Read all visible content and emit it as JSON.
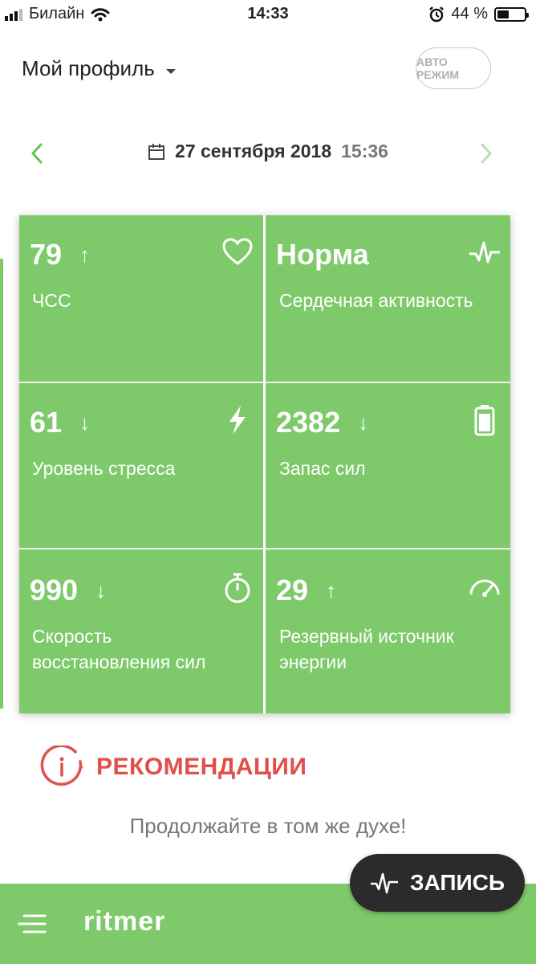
{
  "status_bar": {
    "carrier": "Билайн",
    "time": "14:33",
    "battery_percent": "44 %",
    "battery_level": 0.44
  },
  "header": {
    "profile_label": "Мой профиль",
    "auto_mode_label": "АВТО РЕЖИМ"
  },
  "date_nav": {
    "date": "27 сентября 2018",
    "time": "15:36"
  },
  "metrics": [
    {
      "value": "79",
      "trend": "↑",
      "label": "ЧСС",
      "icon": "heart-icon"
    },
    {
      "value": "Норма",
      "trend": "",
      "label": "Сердечная активность",
      "icon": "pulse-icon"
    },
    {
      "value": "61",
      "trend": "↓",
      "label": "Уровень стресса",
      "icon": "lightning-icon"
    },
    {
      "value": "2382",
      "trend": "↓",
      "label": "Запас сил",
      "icon": "battery-icon"
    },
    {
      "value": "990",
      "trend": "↓",
      "label": "Скорость восстановления сил",
      "icon": "stopwatch-icon"
    },
    {
      "value": "29",
      "trend": "↑",
      "label": "Резервный источник энергии",
      "icon": "gauge-icon"
    }
  ],
  "recommendations": {
    "title": "РЕКОМЕНДАЦИИ",
    "text": "Продолжайте в том же духе!"
  },
  "bottom_bar": {
    "logo": "ritmer",
    "record_label": "ЗАПИСЬ"
  },
  "colors": {
    "card_green": "#7ec96a",
    "accent_red": "#e0504a",
    "record_button": "#2b2b2b"
  }
}
